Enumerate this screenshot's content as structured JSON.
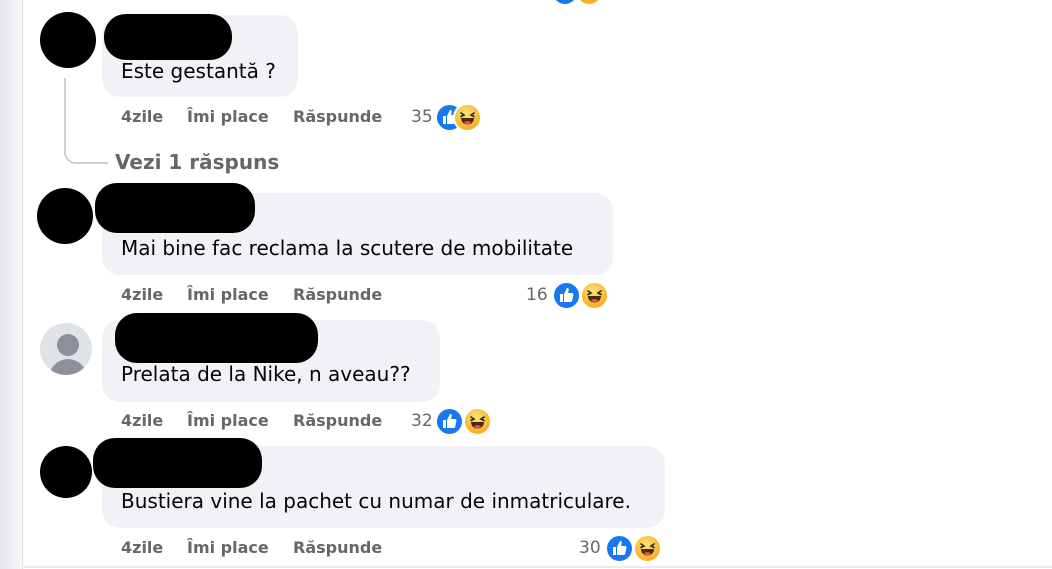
{
  "comments": [
    {
      "text": "Este gestantă ?",
      "time": "4zile",
      "like_label": "Îmi place",
      "reply_label": "Răspunde",
      "reaction_count": "35",
      "reactions": [
        "like-icon",
        "haha-icon"
      ],
      "see_replies": "Vezi 1 răspuns"
    },
    {
      "text": "Mai bine fac reclama la scutere de mobilitate",
      "time": "4zile",
      "like_label": "Îmi place",
      "reply_label": "Răspunde",
      "reaction_count": "16",
      "reactions": [
        "like-icon",
        "haha-icon"
      ]
    },
    {
      "text": "Prelata de la Nike, n aveau??",
      "time": "4zile",
      "like_label": "Îmi place",
      "reply_label": "Răspunde",
      "reaction_count": "32",
      "reactions": [
        "like-icon",
        "haha-icon"
      ]
    },
    {
      "text": "Bustiera vine la pachet cu numar de inmatriculare.",
      "time": "4zile",
      "like_label": "Îmi place",
      "reply_label": "Răspunde",
      "reaction_count": "30",
      "reactions": [
        "like-icon",
        "haha-icon"
      ]
    }
  ],
  "colors": {
    "bubble": "#f0f2f5",
    "secondary_text": "#65676b",
    "like_blue": "#1a77f2",
    "haha_yellow": "#f7b125"
  }
}
